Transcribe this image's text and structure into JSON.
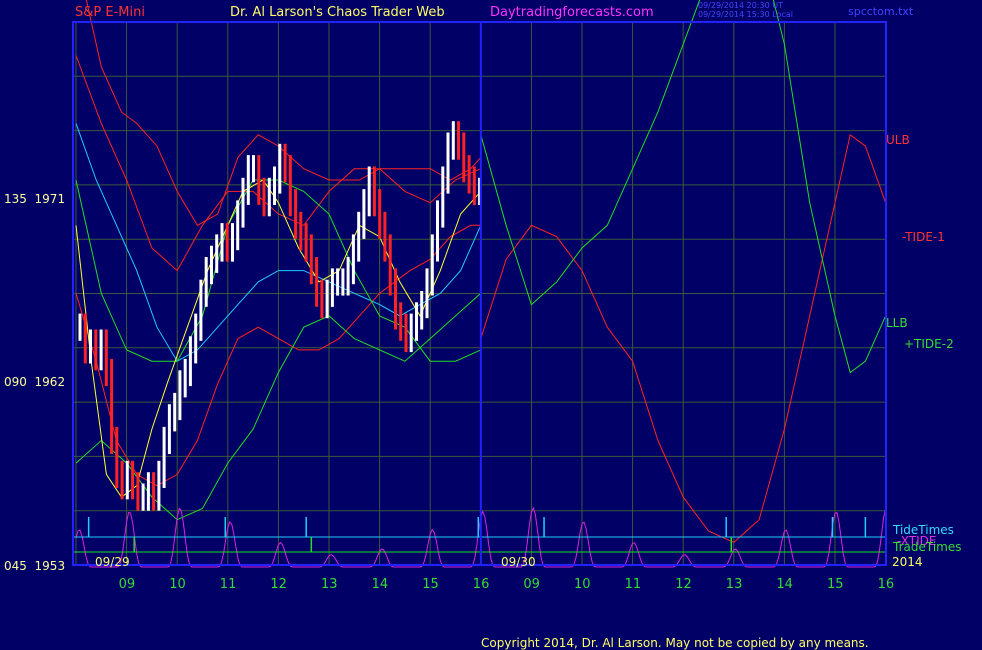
{
  "header": {
    "symbol": "S&P E-Mini",
    "site_title": "Dr. Al Larson's Chaos Trader Web",
    "url": "Daytradingforecasts.com",
    "timestamp_line1": "09/29/2014 20:30 UT",
    "timestamp_line2": "09/29/2014 15:30 Local",
    "filename": "spcctom.txt"
  },
  "footer": {
    "copyright": "Copyright 2014, Dr. Al Larson. May not be copied by any means."
  },
  "colors": {
    "background": "#000066",
    "frame": "#2222ff",
    "grid": "#3a5a3a",
    "red": "#ff2222",
    "green": "#22dd22",
    "cyan": "#22ccff",
    "yellow": "#ffff33",
    "magenta": "#dd22dd",
    "white": "#ffffff",
    "label_yellow": "#ffff99"
  },
  "chart_data": {
    "type": "line",
    "title": "S&P E-Mini",
    "y_axis": {
      "labels": [
        {
          "text": "135  1971",
          "value": 1971
        },
        {
          "text": "090  1962",
          "value": 1962
        },
        {
          "text": "045  1953",
          "value": 1953
        }
      ]
    },
    "x_axis": {
      "date_labels": [
        "09/29",
        "09/30",
        "2014"
      ],
      "hour_labels": [
        "09",
        "10",
        "11",
        "12",
        "13",
        "14",
        "15",
        "16",
        "09",
        "10",
        "11",
        "12",
        "13",
        "14",
        "15",
        "16"
      ]
    },
    "right_labels": [
      {
        "text": "ULB",
        "color": "red"
      },
      {
        "text": "-TIDE-1",
        "color": "red"
      },
      {
        "text": "LLB",
        "color": "green"
      },
      {
        "text": "+TIDE-2",
        "color": "green"
      },
      {
        "text": "TideTimes",
        "color": "cyan"
      },
      {
        "text": "-XTIDE",
        "color": "magenta"
      },
      {
        "text": "TradeTimes",
        "color": "green"
      }
    ],
    "price_bars": [
      1963.5,
      1962.5,
      1962.8,
      1962.2,
      1962.8,
      1961.5,
      1958.5,
      1957,
      1956.5,
      1957,
      1956.5,
      1956,
      1956,
      1956.5,
      1956,
      1957,
      1958.5,
      1959.5,
      1960,
      1961,
      1961.5,
      1962.5,
      1963.5,
      1965,
      1966,
      1966.5,
      1967,
      1967.5,
      1967,
      1967.5,
      1968.5,
      1969.5,
      1970.5,
      1970.5,
      1969.5,
      1969,
      1969.5,
      1970,
      1971,
      1970.5,
      1969,
      1968,
      1967.5,
      1967,
      1966,
      1965,
      1964.5,
      1965,
      1965.5,
      1965.5,
      1965.5,
      1966,
      1967,
      1968,
      1969,
      1970,
      1969,
      1968,
      1967,
      1965.5,
      1964,
      1963.5,
      1963,
      1963.5,
      1964,
      1964.5,
      1965.5,
      1967,
      1968.5,
      1970,
      1971.5,
      1972,
      1971.5,
      1970.5,
      1970,
      1969.5,
      1969.5
    ],
    "series": [
      {
        "name": "Upper band",
        "color": "red",
        "points": [
          [
            0,
            1980
          ],
          [
            0.5,
            1975
          ],
          [
            0.9,
            1973
          ],
          [
            1.2,
            1972.5
          ],
          [
            1.6,
            1971.5
          ],
          [
            2,
            1969.5
          ],
          [
            2.4,
            1968
          ],
          [
            2.8,
            1968.5
          ],
          [
            3.2,
            1971
          ],
          [
            3.6,
            1972
          ],
          [
            4,
            1971.5
          ],
          [
            4.5,
            1970.5
          ],
          [
            5,
            1970
          ],
          [
            5.6,
            1970
          ],
          [
            6,
            1970.5
          ],
          [
            6.6,
            1970.5
          ],
          [
            7,
            1970.5
          ],
          [
            7.4,
            1970
          ],
          [
            7.8,
            1970.5
          ],
          [
            8,
            1971
          ]
        ]
      },
      {
        "name": "Middle red",
        "color": "red",
        "points": [
          [
            0,
            1975.5
          ],
          [
            0.5,
            1972.5
          ],
          [
            1,
            1970
          ],
          [
            1.5,
            1967
          ],
          [
            2,
            1966
          ],
          [
            2.5,
            1968
          ],
          [
            3,
            1969.5
          ],
          [
            3.5,
            1969.5
          ],
          [
            4,
            1968.5
          ],
          [
            4.5,
            1968
          ],
          [
            5,
            1969.5
          ],
          [
            5.5,
            1970.5
          ],
          [
            6,
            1970.5
          ],
          [
            6.5,
            1969.5
          ],
          [
            7,
            1969
          ],
          [
            7.5,
            1970
          ],
          [
            8,
            1970.5
          ]
        ]
      },
      {
        "name": "Lower red",
        "color": "red",
        "points": [
          [
            0,
            1965
          ],
          [
            0.4,
            1962
          ],
          [
            0.8,
            1958.5
          ],
          [
            1.2,
            1957
          ],
          [
            1.6,
            1956.5
          ],
          [
            2,
            1957
          ],
          [
            2.4,
            1958.5
          ],
          [
            2.8,
            1961
          ],
          [
            3.2,
            1963
          ],
          [
            3.6,
            1963.5
          ],
          [
            4,
            1963
          ],
          [
            4.4,
            1962.5
          ],
          [
            4.8,
            1962.5
          ],
          [
            5.2,
            1963
          ],
          [
            5.6,
            1964
          ],
          [
            6,
            1965
          ],
          [
            6.6,
            1966
          ],
          [
            7,
            1966.5
          ],
          [
            7.4,
            1967.5
          ],
          [
            7.8,
            1968
          ],
          [
            8,
            1968
          ]
        ]
      },
      {
        "name": "Cyan average",
        "color": "cyan",
        "points": [
          [
            0,
            1972.5
          ],
          [
            0.4,
            1970
          ],
          [
            0.8,
            1968
          ],
          [
            1.2,
            1966
          ],
          [
            1.6,
            1963.5
          ],
          [
            2,
            1962
          ],
          [
            2.4,
            1962.5
          ],
          [
            2.8,
            1963.5
          ],
          [
            3.2,
            1964.5
          ],
          [
            3.6,
            1965.5
          ],
          [
            4,
            1966
          ],
          [
            4.5,
            1966
          ],
          [
            5,
            1965.5
          ],
          [
            5.5,
            1965
          ],
          [
            6,
            1964.5
          ],
          [
            6.4,
            1964
          ],
          [
            6.8,
            1964.5
          ],
          [
            7.2,
            1965
          ],
          [
            7.6,
            1966
          ],
          [
            8,
            1968
          ]
        ]
      },
      {
        "name": "Green upper",
        "color": "green",
        "points": [
          [
            0,
            1970
          ],
          [
            0.5,
            1965
          ],
          [
            1,
            1962.5
          ],
          [
            1.5,
            1962
          ],
          [
            2,
            1962
          ],
          [
            2.5,
            1964
          ],
          [
            3,
            1968
          ],
          [
            3.5,
            1970
          ],
          [
            4,
            1970
          ],
          [
            4.5,
            1969.5
          ],
          [
            5,
            1968.5
          ],
          [
            5.5,
            1966
          ],
          [
            6,
            1964
          ],
          [
            6.5,
            1963.5
          ],
          [
            7,
            1962
          ],
          [
            7.5,
            1962
          ],
          [
            8,
            1962.5
          ]
        ]
      },
      {
        "name": "Green lower",
        "color": "green",
        "points": [
          [
            0,
            1957.5
          ],
          [
            0.5,
            1958.5
          ],
          [
            1,
            1957.5
          ],
          [
            1.5,
            1956
          ],
          [
            2,
            1955
          ],
          [
            2.5,
            1955.5
          ],
          [
            3,
            1957.5
          ],
          [
            3.5,
            1959
          ],
          [
            4,
            1961.5
          ],
          [
            4.5,
            1963.5
          ],
          [
            5,
            1964
          ],
          [
            5.5,
            1963
          ],
          [
            6,
            1962.5
          ],
          [
            6.5,
            1962
          ],
          [
            7,
            1963
          ],
          [
            7.5,
            1964
          ],
          [
            8,
            1965
          ]
        ]
      },
      {
        "name": "Yellow",
        "color": "yellow",
        "points": [
          [
            0,
            1968
          ],
          [
            0.3,
            1962
          ],
          [
            0.6,
            1957
          ],
          [
            0.9,
            1956
          ],
          [
            1.2,
            1956.5
          ],
          [
            1.5,
            1959
          ],
          [
            1.8,
            1961
          ],
          [
            2.2,
            1963.5
          ],
          [
            2.6,
            1966
          ],
          [
            3,
            1968
          ],
          [
            3.3,
            1969.5
          ],
          [
            3.7,
            1970
          ],
          [
            4,
            1969
          ],
          [
            4.4,
            1967
          ],
          [
            4.8,
            1965.5
          ],
          [
            5.2,
            1966
          ],
          [
            5.6,
            1968
          ],
          [
            6,
            1967.5
          ],
          [
            6.4,
            1965.5
          ],
          [
            6.8,
            1964
          ],
          [
            7.2,
            1966
          ],
          [
            7.6,
            1968.5
          ],
          [
            8,
            1969.5
          ]
        ]
      },
      {
        "name": "-TIDE-1",
        "color": "red",
        "points": [
          [
            8,
            1963
          ],
          [
            8.5,
            1966.5
          ],
          [
            9,
            1968
          ],
          [
            9.5,
            1967.5
          ],
          [
            10,
            1966
          ],
          [
            10.5,
            1963.5
          ],
          [
            11,
            1962
          ],
          [
            11.5,
            1958.5
          ],
          [
            12,
            1956
          ],
          [
            12.5,
            1954.5
          ],
          [
            13,
            1954
          ],
          [
            13.5,
            1955
          ],
          [
            14,
            1959
          ],
          [
            14.5,
            1964
          ],
          [
            15,
            1969
          ],
          [
            15.3,
            1972
          ],
          [
            15.6,
            1971.5
          ],
          [
            16,
            1969
          ]
        ]
      },
      {
        "name": "+TIDE-2",
        "color": "green",
        "points": [
          [
            8,
            1972
          ],
          [
            8.5,
            1968
          ],
          [
            9,
            1964.5
          ],
          [
            9.5,
            1965.5
          ],
          [
            10,
            1967
          ],
          [
            10.5,
            1968
          ],
          [
            11,
            1970.5
          ],
          [
            11.5,
            1973
          ],
          [
            12,
            1976
          ],
          [
            12.5,
            1979
          ],
          [
            13,
            1980.5
          ],
          [
            13.5,
            1980.5
          ],
          [
            14,
            1976
          ],
          [
            14.5,
            1969
          ],
          [
            15,
            1964
          ],
          [
            15.3,
            1961.5
          ],
          [
            15.6,
            1962
          ],
          [
            16,
            1964
          ]
        ]
      }
    ],
    "xtide": {
      "name": "-XTIDE",
      "color": "magenta"
    },
    "tide_times": [
      0.25,
      2.95,
      4.55,
      7.95,
      9.25,
      12.85,
      14.95,
      15.6
    ],
    "trade_times": [
      1.15,
      4.65,
      12.95
    ]
  }
}
